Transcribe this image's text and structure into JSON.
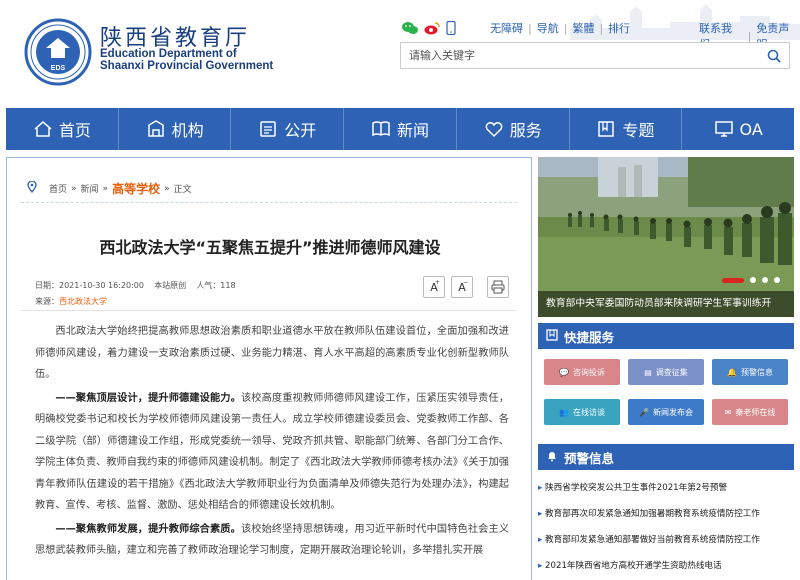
{
  "header": {
    "title_cn": "陕西省教育厅",
    "title_en_1": "Education Department of",
    "title_en_2": "Shaanxi Provincial Government",
    "emblem_text": "EDS",
    "top_links": [
      "无障碍",
      "导航",
      "繁體",
      "排行"
    ],
    "right_links": [
      "联系我们",
      "免责声明"
    ],
    "search_placeholder": "请输入关键字",
    "social_icons": [
      "wechat-icon",
      "weibo-icon",
      "mobile-icon"
    ]
  },
  "nav": {
    "items": [
      {
        "label": "首页",
        "icon": "home-icon"
      },
      {
        "label": "机构",
        "icon": "building-icon"
      },
      {
        "label": "公开",
        "icon": "document-icon"
      },
      {
        "label": "新闻",
        "icon": "book-icon"
      },
      {
        "label": "服务",
        "icon": "heart-icon"
      },
      {
        "label": "专题",
        "icon": "bookmark-icon"
      },
      {
        "label": "OA",
        "icon": "monitor-icon"
      }
    ]
  },
  "breadcrumb": {
    "home": "首页",
    "news": "新闻",
    "category": "高等学校",
    "current": "正文"
  },
  "article": {
    "title": "西北政法大学“五聚焦五提升”推进师德师风建设",
    "date_label": "日期：2021-10-30 16:20:00",
    "original_label": "本站原创",
    "views_label": "人气：118",
    "source_label": "来源：",
    "source_value": "西北政法大学",
    "font_increase": "A",
    "font_decrease": "A",
    "paragraphs": [
      {
        "lead": "",
        "text": "西北政法大学始终把提高教师思想政治素质和职业道德水平放在教师队伍建设首位，全面加强和改进师德师风建设，着力建设一支政治素质过硬、业务能力精湛、育人水平高超的高素质专业化创新型教师队伍。"
      },
      {
        "lead": "——聚焦顶层设计，提升师德建设能力。",
        "text": "该校高度重视教师师德师风建设工作，压紧压实领导责任，明确校党委书记和校长为学校师德师风建设第一责任人。成立学校师德建设委员会、党委教师工作部、各二级学院（部）师德建设工作组，形成党委统一领导、党政齐抓共管、职能部门统筹、各部门分工合作、学院主体负责、教师自我约束的师德师风建设机制。制定了《西北政法大学教师师德考核办法》《关于加强青年教师队伍建设的若干措施》《西北政法大学教师职业行为负面清单及师德失范行为处理办法》，构建起教育、宣传、考核、监督、激励、惩处相结合的师德建设长效机制。"
      },
      {
        "lead": "——聚焦教师发展，提升教师综合素质。",
        "text": "该校始终坚持思想铸魂，用习近平新时代中国特色社会主义思想武装教师头脑，建立和完善了教师政治理论学习制度，定期开展政治理论轮训，多举措扎实开展"
      }
    ]
  },
  "hero": {
    "caption": "教育部中央军委国防动员部来陕调研学生军事训练开"
  },
  "quick_service": {
    "title": "快捷服务",
    "buttons": [
      {
        "label": "咨询投诉",
        "color": "#d9868a",
        "icon": "chat-icon"
      },
      {
        "label": "调查征集",
        "color": "#7b8fc9",
        "icon": "survey-icon"
      },
      {
        "label": "预警信息",
        "color": "#4b84c6",
        "icon": "alarm-icon"
      },
      {
        "label": "在线访谈",
        "color": "#3aa3bf",
        "icon": "people-icon"
      },
      {
        "label": "新闻发布会",
        "color": "#3d7bc9",
        "icon": "mic-icon"
      },
      {
        "label": "秦老师在线",
        "color": "#d9868a",
        "icon": "mail-icon"
      }
    ]
  },
  "warnings": {
    "title": "预警信息",
    "items": [
      "陕西省学校突发公共卫生事件2021年第2号预警",
      "教育部再次印发紧急通知加强暑期教育系统疫情防控工作",
      "教育部印发紧急通知部署做好当前教育系统疫情防控工作",
      "2021年陕西省地方高校开通学生资助热线电话"
    ]
  }
}
